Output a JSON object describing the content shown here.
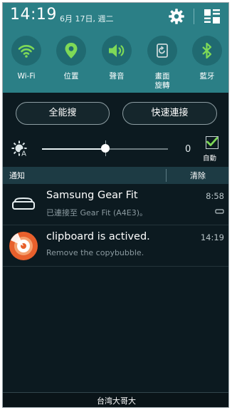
{
  "status_bar": {
    "time": "14:19",
    "date": "6月 17日, 週二",
    "icons": [
      "gear-icon",
      "grid-icon"
    ]
  },
  "quick_toggles": [
    {
      "label": "Wi-Fi",
      "icon": "wifi-icon"
    },
    {
      "label": "位置",
      "icon": "location-icon"
    },
    {
      "label": "聲音",
      "icon": "sound-icon"
    },
    {
      "label": "畫面\n旋轉",
      "icon": "rotate-icon"
    },
    {
      "label": "藍牙",
      "icon": "bluetooth-icon"
    }
  ],
  "buttons": {
    "search_label": "全能搜",
    "quick_connect_label": "快速連接"
  },
  "brightness": {
    "value_label": "0",
    "level": 0.5,
    "auto_label": "自動",
    "auto_checked": true
  },
  "notifications_header": {
    "title": "通知",
    "clear_label": "清除"
  },
  "notifications": [
    {
      "title": "Samsung Gear Fit",
      "subtitle": "已連接至 Gear Fit (A4E3)。",
      "time": "8:58",
      "icon": "gear-fit-icon"
    },
    {
      "title": "clipboard is actived.",
      "subtitle": "Remove the copybubble.",
      "time": "14:19",
      "icon": "clipboard-bubble-icon"
    }
  ],
  "carrier": "台湾大哥大",
  "colors": {
    "panel": "#2b7f86",
    "toggle_circle": "#206a71",
    "toggle_icon_active": "#7ed957",
    "background": "#0c1a20",
    "clipboard_orange": "#e8602c"
  }
}
